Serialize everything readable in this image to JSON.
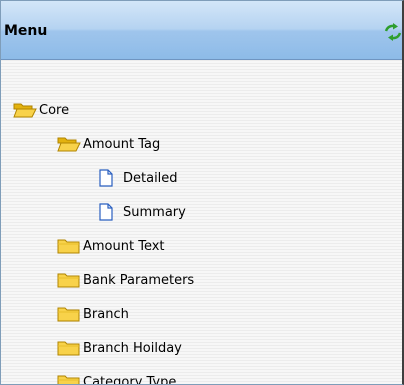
{
  "panel": {
    "title": "Menu",
    "refresh_icon": "refresh-icon"
  },
  "tree": {
    "items": [
      {
        "label": "Core",
        "icon": "open-folder-icon",
        "level": 0
      },
      {
        "label": "Amount Tag",
        "icon": "open-folder-icon",
        "level": 1
      },
      {
        "label": "Detailed",
        "icon": "document-icon",
        "level": 2
      },
      {
        "label": "Summary",
        "icon": "document-icon",
        "level": 2
      },
      {
        "label": "Amount Text",
        "icon": "folder-icon",
        "level": 1
      },
      {
        "label": "Bank Parameters",
        "icon": "folder-icon",
        "level": 1
      },
      {
        "label": "Branch",
        "icon": "folder-icon",
        "level": 1
      },
      {
        "label": "Branch Hoilday",
        "icon": "folder-icon",
        "level": 1
      },
      {
        "label": "Category Type",
        "icon": "folder-icon",
        "level": 1
      }
    ]
  },
  "colors": {
    "header_top": "#d3e6f8",
    "header_bottom": "#8dbbe8",
    "folder_fill": "#f8d24a",
    "folder_dark": "#c49600",
    "document_stroke": "#2a5fc0",
    "refresh_green": "#2e9e2e",
    "border_blue": "#7f9db9"
  }
}
